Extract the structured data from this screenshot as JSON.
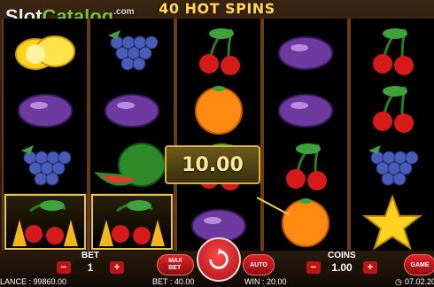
{
  "game": {
    "title": "40 HOT SPINS"
  },
  "logo": {
    "slot": "Slot",
    "catalog": "Catalog",
    "com": ".com"
  },
  "win": {
    "amount": "10.00"
  },
  "controls": {
    "bet_label": "BET",
    "bet_value": "1",
    "coins_label": "COINS",
    "coins_value": "1.00",
    "max_bet_label": "MAX\nBET",
    "auto_label": "AUTO",
    "game_label": "GAME"
  },
  "status": {
    "balance": "LANCE : 99860.00",
    "bet": "BET : 40.00",
    "win": "WIN : 20.00",
    "date": "07.02.20"
  },
  "reels": [
    [
      "lemon",
      "plum",
      "grape",
      "cherry-fire"
    ],
    [
      "grape",
      "plum",
      "watermelon",
      "cherry-fire"
    ],
    [
      "cherry",
      "orange",
      "cherry",
      "plum"
    ],
    [
      "plum",
      "plum",
      "cherry",
      "orange"
    ],
    [
      "cherry",
      "cherry",
      "grape",
      "star"
    ]
  ]
}
